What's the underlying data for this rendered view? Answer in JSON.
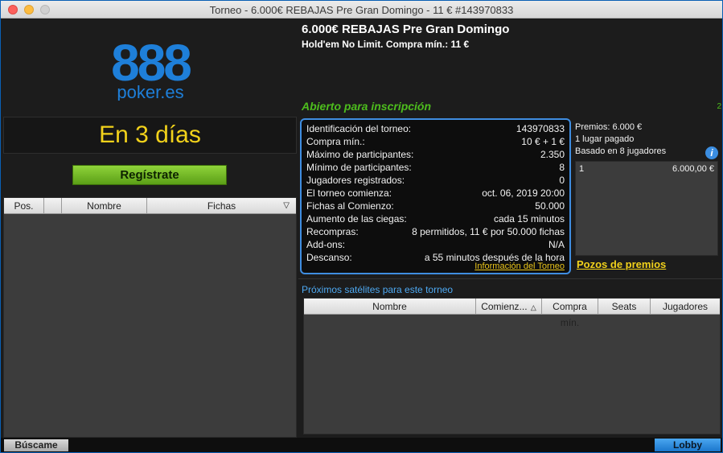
{
  "window": {
    "title": "Torneo - 6.000€ REBAJAS Pre Gran Domingo - 11 € #143970833"
  },
  "logo": {
    "number": "888",
    "domain": "poker.es",
    "color": "#1e7fd9"
  },
  "left": {
    "countdown": "En 3 días",
    "register_label": "Regístrate",
    "table_headers": [
      "Pos.",
      "",
      "Nombre",
      "Fichas"
    ]
  },
  "tournament": {
    "name": "6.000€ REBAJAS Pre Gran Domingo",
    "subtitle": "Hold'em No Limit. Compra mín.: 11 €",
    "status": "Abierto para inscripción",
    "status_extra": "2",
    "info_rows": [
      {
        "label": "Identificación del torneo:",
        "value": "143970833"
      },
      {
        "label": "Compra mín.:",
        "value": "10 € + 1 €"
      },
      {
        "label": "Máximo de participantes:",
        "value": "2.350"
      },
      {
        "label": "Mínimo de participantes:",
        "value": "8"
      },
      {
        "label": "Jugadores registrados:",
        "value": "0"
      },
      {
        "label": "El torneo comienza:",
        "value": "oct. 06, 2019 20:00"
      },
      {
        "label": "Fichas al Comienzo:",
        "value": "50.000"
      },
      {
        "label": "Aumento de las ciegas:",
        "value": "cada 15 minutos"
      },
      {
        "label": "Recompras:",
        "value": "8 permitidos, 11 € por 50.000 fichas"
      },
      {
        "label": "Add-ons:",
        "value": "N/A"
      },
      {
        "label": "Descanso:",
        "value": "a 55 minutos después de la hora"
      }
    ],
    "info_link": "Información del Torneo"
  },
  "prizes": {
    "pool": "Premios: 6.000 €",
    "paid": "1 lugar pagado",
    "based": "Basado en 8 jugadores",
    "rows": [
      {
        "place": "1",
        "amount": "6.000,00 €"
      }
    ],
    "link": "Pozos de premios"
  },
  "satellites": {
    "title": "Próximos satélites para este torneo",
    "headers": [
      "Nombre",
      "Comienz...",
      "Compra mín.",
      "Seats",
      "Jugadores"
    ]
  },
  "bottom": {
    "buscame": "Búscame",
    "lobby": "Lobby"
  }
}
